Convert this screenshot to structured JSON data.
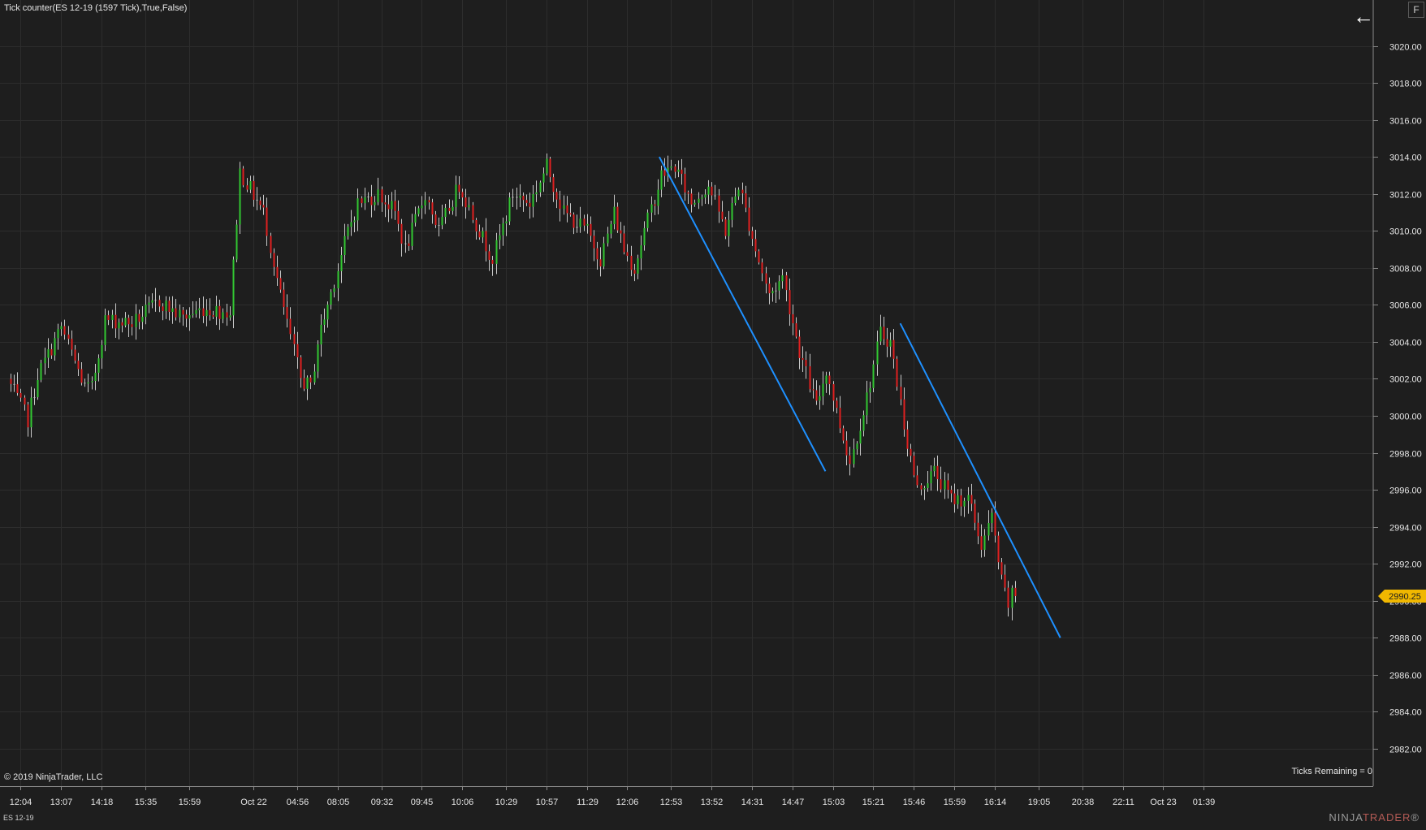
{
  "header": {
    "indicator_label": "Tick counter(ES 12-19 (1597 Tick),True,False)"
  },
  "footer": {
    "copyright": "© 2019 NinjaTrader, LLC",
    "ticks_remaining": "Ticks Remaining = 0",
    "instrument": "ES 12-19",
    "brand_part1": "NINJA",
    "brand_part2": "TRADER",
    "brand_mark": "®"
  },
  "controls": {
    "back_icon": "back-arrow-icon",
    "back_glyph": "←",
    "f_label": "F"
  },
  "colors": {
    "background": "#1e1e1e",
    "grid": "#2d2d2d",
    "up": "#32c832",
    "down": "#e02020",
    "neutral": "#c8c8c8",
    "trendline": "#1e90ff",
    "price_marker": "#f0b700"
  },
  "chart_data": {
    "type": "candlestick",
    "y_axis": {
      "min": 2981,
      "max": 3022,
      "ticks": [
        2982,
        2984,
        2986,
        2988,
        2990,
        2992,
        2994,
        2996,
        2998,
        3000,
        3002,
        3004,
        3006,
        3008,
        3010,
        3012,
        3014,
        3016,
        3018,
        3020
      ],
      "labels": [
        "2982.00",
        "2984.00",
        "2986.00",
        "2988.00",
        "2990.00",
        "2992.00",
        "2994.00",
        "2996.00",
        "2998.00",
        "3000.00",
        "3002.00",
        "3004.00",
        "3006.00",
        "3008.00",
        "3010.00",
        "3012.00",
        "3014.00",
        "3016.00",
        "3018.00",
        "3020.00"
      ]
    },
    "x_axis": {
      "bar_count": 300,
      "labels": [
        "12:04",
        "13:07",
        "14:18",
        "15:35",
        "15:59",
        "Oct 22",
        "04:56",
        "08:05",
        "09:32",
        "09:45",
        "10:06",
        "10:29",
        "10:57",
        "11:29",
        "12:06",
        "12:53",
        "13:52",
        "14:31",
        "14:47",
        "15:03",
        "15:21",
        "15:46",
        "15:59",
        "16:14",
        "19:05",
        "20:38",
        "22:11",
        "Oct 23",
        "01:39"
      ],
      "label_bar_index": [
        3,
        15,
        27,
        40,
        53,
        72,
        85,
        97,
        110,
        122,
        134,
        147,
        159,
        171,
        183,
        196,
        208,
        220,
        232,
        244,
        256,
        268,
        280,
        292,
        305,
        318,
        330,
        342,
        354
      ]
    },
    "price_path": [
      [
        0,
        3002.0
      ],
      [
        6,
        2999.8
      ],
      [
        9,
        3002.2
      ],
      [
        16,
        3004.8
      ],
      [
        23,
        3001.5
      ],
      [
        25,
        3001.5
      ],
      [
        29,
        3005.2
      ],
      [
        37,
        3005.0
      ],
      [
        45,
        3006.2
      ],
      [
        52,
        3005.3
      ],
      [
        58,
        3005.8
      ],
      [
        66,
        3005.6
      ],
      [
        69,
        3013.2
      ],
      [
        76,
        3011.0
      ],
      [
        81,
        3006.5
      ],
      [
        87,
        3002.0
      ],
      [
        90,
        3001.5
      ],
      [
        92,
        3004.0
      ],
      [
        98,
        3008.0
      ],
      [
        101,
        3010.0
      ],
      [
        104,
        3011.5
      ],
      [
        110,
        3012.0
      ],
      [
        115,
        3011.0
      ],
      [
        118,
        3009.0
      ],
      [
        124,
        3012.0
      ],
      [
        128,
        3010.0
      ],
      [
        134,
        3012.5
      ],
      [
        140,
        3010.0
      ],
      [
        144,
        3008.5
      ],
      [
        150,
        3012.0
      ],
      [
        155,
        3011.5
      ],
      [
        160,
        3013.5
      ],
      [
        165,
        3011.0
      ],
      [
        172,
        3010.0
      ],
      [
        176,
        3008.5
      ],
      [
        180,
        3011.0
      ],
      [
        183,
        3009.0
      ],
      [
        186,
        3008.0
      ],
      [
        189,
        3010.0
      ],
      [
        194,
        3013.0
      ],
      [
        198,
        3013.5
      ],
      [
        203,
        3011.5
      ],
      [
        208,
        3012.5
      ],
      [
        213,
        3010.0
      ],
      [
        217,
        3012.5
      ],
      [
        222,
        3009.0
      ],
      [
        226,
        3006.5
      ],
      [
        230,
        3007.5
      ],
      [
        235,
        3003.5
      ],
      [
        240,
        3000.5
      ],
      [
        243,
        3002.5
      ],
      [
        247,
        2999.5
      ],
      [
        250,
        2997.5
      ],
      [
        255,
        3001.0
      ],
      [
        259,
        3004.5
      ],
      [
        262,
        3004.0
      ],
      [
        267,
        2998.5
      ],
      [
        270,
        2996.0
      ],
      [
        275,
        2997.0
      ],
      [
        280,
        2995.5
      ],
      [
        285,
        2995.5
      ],
      [
        289,
        2993.0
      ],
      [
        292,
        2994.5
      ],
      [
        295,
        2991.0
      ],
      [
        297,
        2989.8
      ],
      [
        298,
        2990.25
      ]
    ],
    "last_price": 2990.25,
    "last_price_label": "2990.25",
    "trendlines": [
      {
        "from": {
          "bar": 192.5,
          "price": 3014.0
        },
        "to": {
          "bar": 241.8,
          "price": 2997.0
        }
      },
      {
        "from": {
          "bar": 264.0,
          "price": 3005.0
        },
        "to": {
          "bar": 311.5,
          "price": 2988.0
        }
      }
    ]
  }
}
